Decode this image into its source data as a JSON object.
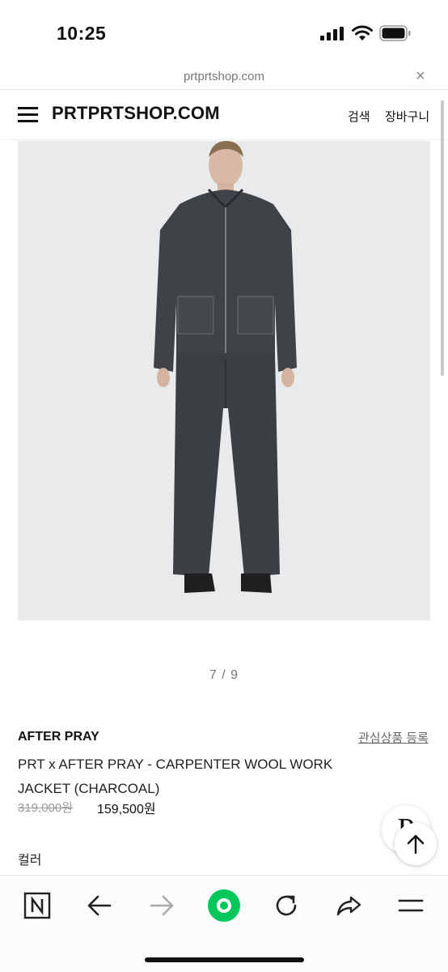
{
  "status": {
    "time": "10:25"
  },
  "browser": {
    "url": "prtprtshop.com",
    "close_glyph": "×"
  },
  "header": {
    "logo": "PRTPRTSHOP.COM",
    "search_label": "검색",
    "cart_label": "장바구니"
  },
  "gallery": {
    "pager": "7 / 9"
  },
  "product": {
    "brand": "AFTER PRAY",
    "wishlist_label": "관심상품 등록",
    "name": "PRT x AFTER PRAY - CARPENTER WOOL WORK JACKET (CHARCOAL)",
    "original_price": "319,000원",
    "sale_price": "159,500원",
    "color_label": "컬러"
  },
  "floating": {
    "logo_letter": "P"
  },
  "icons": {
    "menu": "hamburger-icon",
    "bottom": [
      "naver-n-icon",
      "back-arrow-icon",
      "forward-arrow-icon",
      "green-dot-icon",
      "refresh-icon",
      "share-icon",
      "menu-icon"
    ]
  },
  "colors": {
    "accent_green": "#03c75a",
    "text": "#111111",
    "muted": "#777777"
  }
}
